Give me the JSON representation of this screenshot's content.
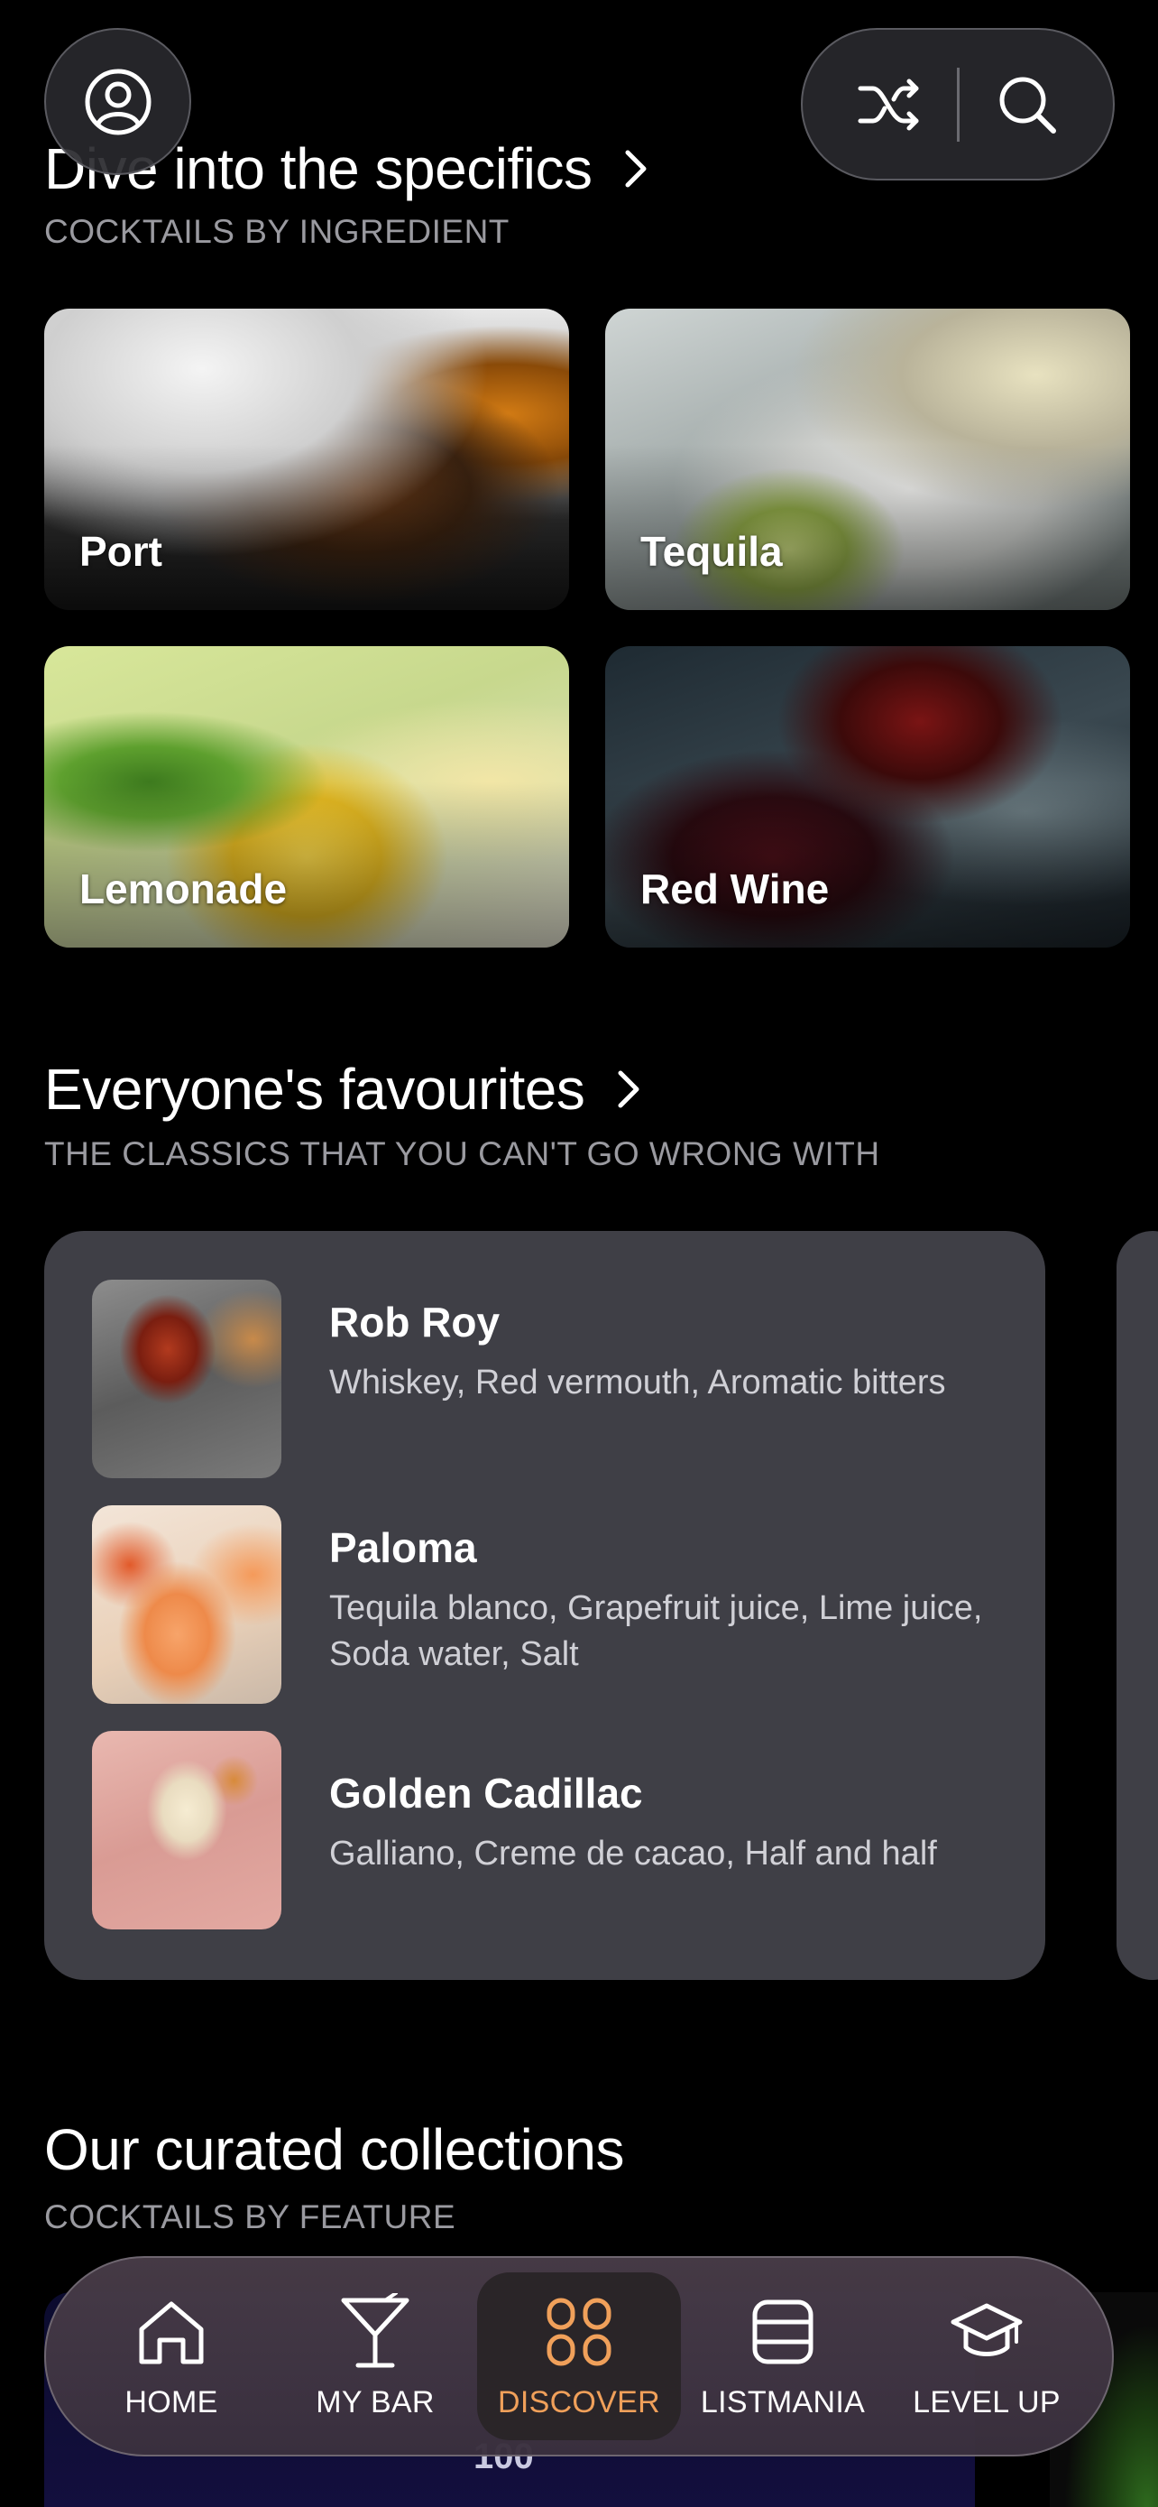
{
  "header": {
    "profile_icon": "user-circle-icon",
    "shuffle_icon": "shuffle-icon",
    "search_icon": "search-icon"
  },
  "specifics": {
    "title": "Dive into the specifics",
    "subtitle": "COCKTAILS BY INGREDIENT",
    "tiles": [
      {
        "label": "Port"
      },
      {
        "label": "Tequila"
      },
      {
        "label": "Lemonade"
      },
      {
        "label": "Red Wine"
      }
    ]
  },
  "favourites": {
    "title": "Everyone's favourites",
    "subtitle": "THE CLASSICS THAT YOU CAN'T GO WRONG WITH",
    "items": [
      {
        "name": "Rob Roy",
        "ingredients": "Whiskey, Red vermouth, Aromatic bitters"
      },
      {
        "name": "Paloma",
        "ingredients": "Tequila blanco, Grapefruit juice, Lime juice, Soda water, Salt"
      },
      {
        "name": "Golden Cadillac",
        "ingredients": "Galliano, Creme de cacao, Half and half"
      }
    ]
  },
  "collections": {
    "title": "Our curated collections",
    "subtitle": "COCKTAILS BY FEATURE",
    "badge": "100"
  },
  "nav": {
    "items": [
      {
        "label": "HOME",
        "icon": "home-icon"
      },
      {
        "label": "MY BAR",
        "icon": "martini-glass-icon"
      },
      {
        "label": "DISCOVER",
        "icon": "grid-icon",
        "active": true
      },
      {
        "label": "LISTMANIA",
        "icon": "list-icon"
      },
      {
        "label": "LEVEL UP",
        "icon": "graduation-cap-icon"
      }
    ],
    "active_color": "#f0a05a"
  }
}
